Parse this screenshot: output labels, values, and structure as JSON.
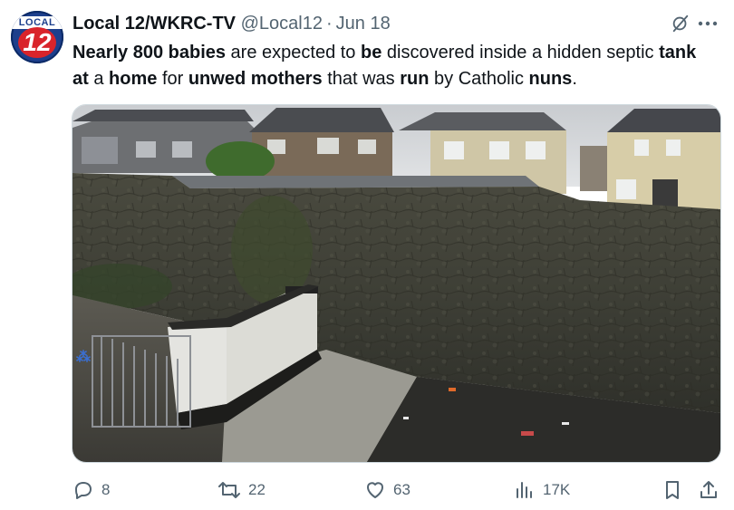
{
  "author": {
    "display_name": "Local 12/WKRC-TV",
    "handle": "@Local12",
    "separator": "·",
    "date": "Jun 18",
    "avatar_text_top": "LOCAL",
    "avatar_text_num": "12"
  },
  "tweet": {
    "segments": [
      {
        "text": "Nearly 800 babies",
        "bold": true
      },
      {
        "text": " are expected to ",
        "bold": false
      },
      {
        "text": "be",
        "bold": true
      },
      {
        "text": " discovered inside a hidden septic ",
        "bold": false
      },
      {
        "text": "tank at",
        "bold": true
      },
      {
        "text": " a ",
        "bold": false
      },
      {
        "text": "home",
        "bold": true
      },
      {
        "text": " for ",
        "bold": false
      },
      {
        "text": "unwed mothers",
        "bold": true
      },
      {
        "text": " that was ",
        "bold": false
      },
      {
        "text": "run",
        "bold": true
      },
      {
        "text": " by Catholic ",
        "bold": false
      },
      {
        "text": "nuns",
        "bold": true
      },
      {
        "text": ".",
        "bold": false
      }
    ]
  },
  "actions": {
    "replies": "8",
    "reposts": "22",
    "likes": "63",
    "views": "17K"
  },
  "icons": {
    "grok": "grok-icon",
    "more": "more-icon",
    "reply": "reply-icon",
    "repost": "repost-icon",
    "like": "heart-icon",
    "views": "views-icon",
    "bookmark": "bookmark-icon",
    "share": "share-icon"
  },
  "colors": {
    "text": "#0f1419",
    "muted": "#536471",
    "avatar_bg": "#1d3f8c",
    "avatar_red": "#d9242b"
  }
}
